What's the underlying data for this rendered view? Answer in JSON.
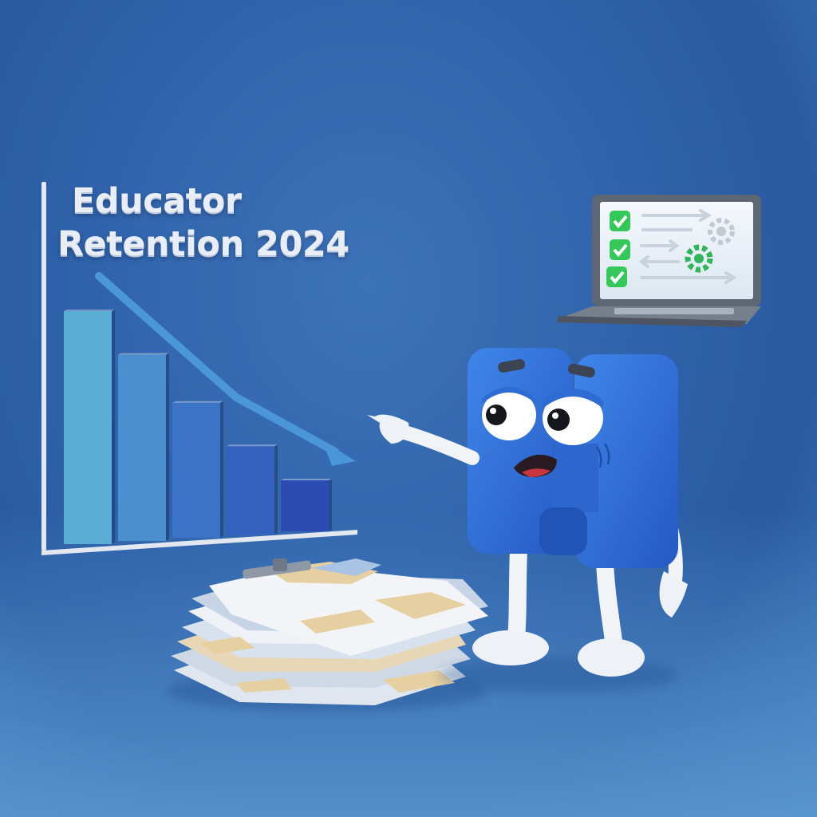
{
  "scene": {
    "title_line1": "Educator",
    "title_line2": "Retention 2024"
  },
  "chart_data": {
    "type": "bar",
    "title": "Educator Retention 2024",
    "values": [
      100,
      80,
      58,
      38,
      22
    ],
    "trend": "decreasing",
    "bar_colors": [
      "#5aaed6",
      "#4a8fd0",
      "#3d73c6",
      "#3461bd",
      "#2d4cb3"
    ]
  },
  "colors": {
    "background": "#2f62aa",
    "axis": "#e3e8f0",
    "character": "#2f6fd6",
    "check_green": "#34c759"
  },
  "icons": [
    "laptop-icon",
    "checkmark-icon",
    "gear-icon",
    "arrow-icon",
    "paper-stack",
    "clipboard-clip"
  ]
}
